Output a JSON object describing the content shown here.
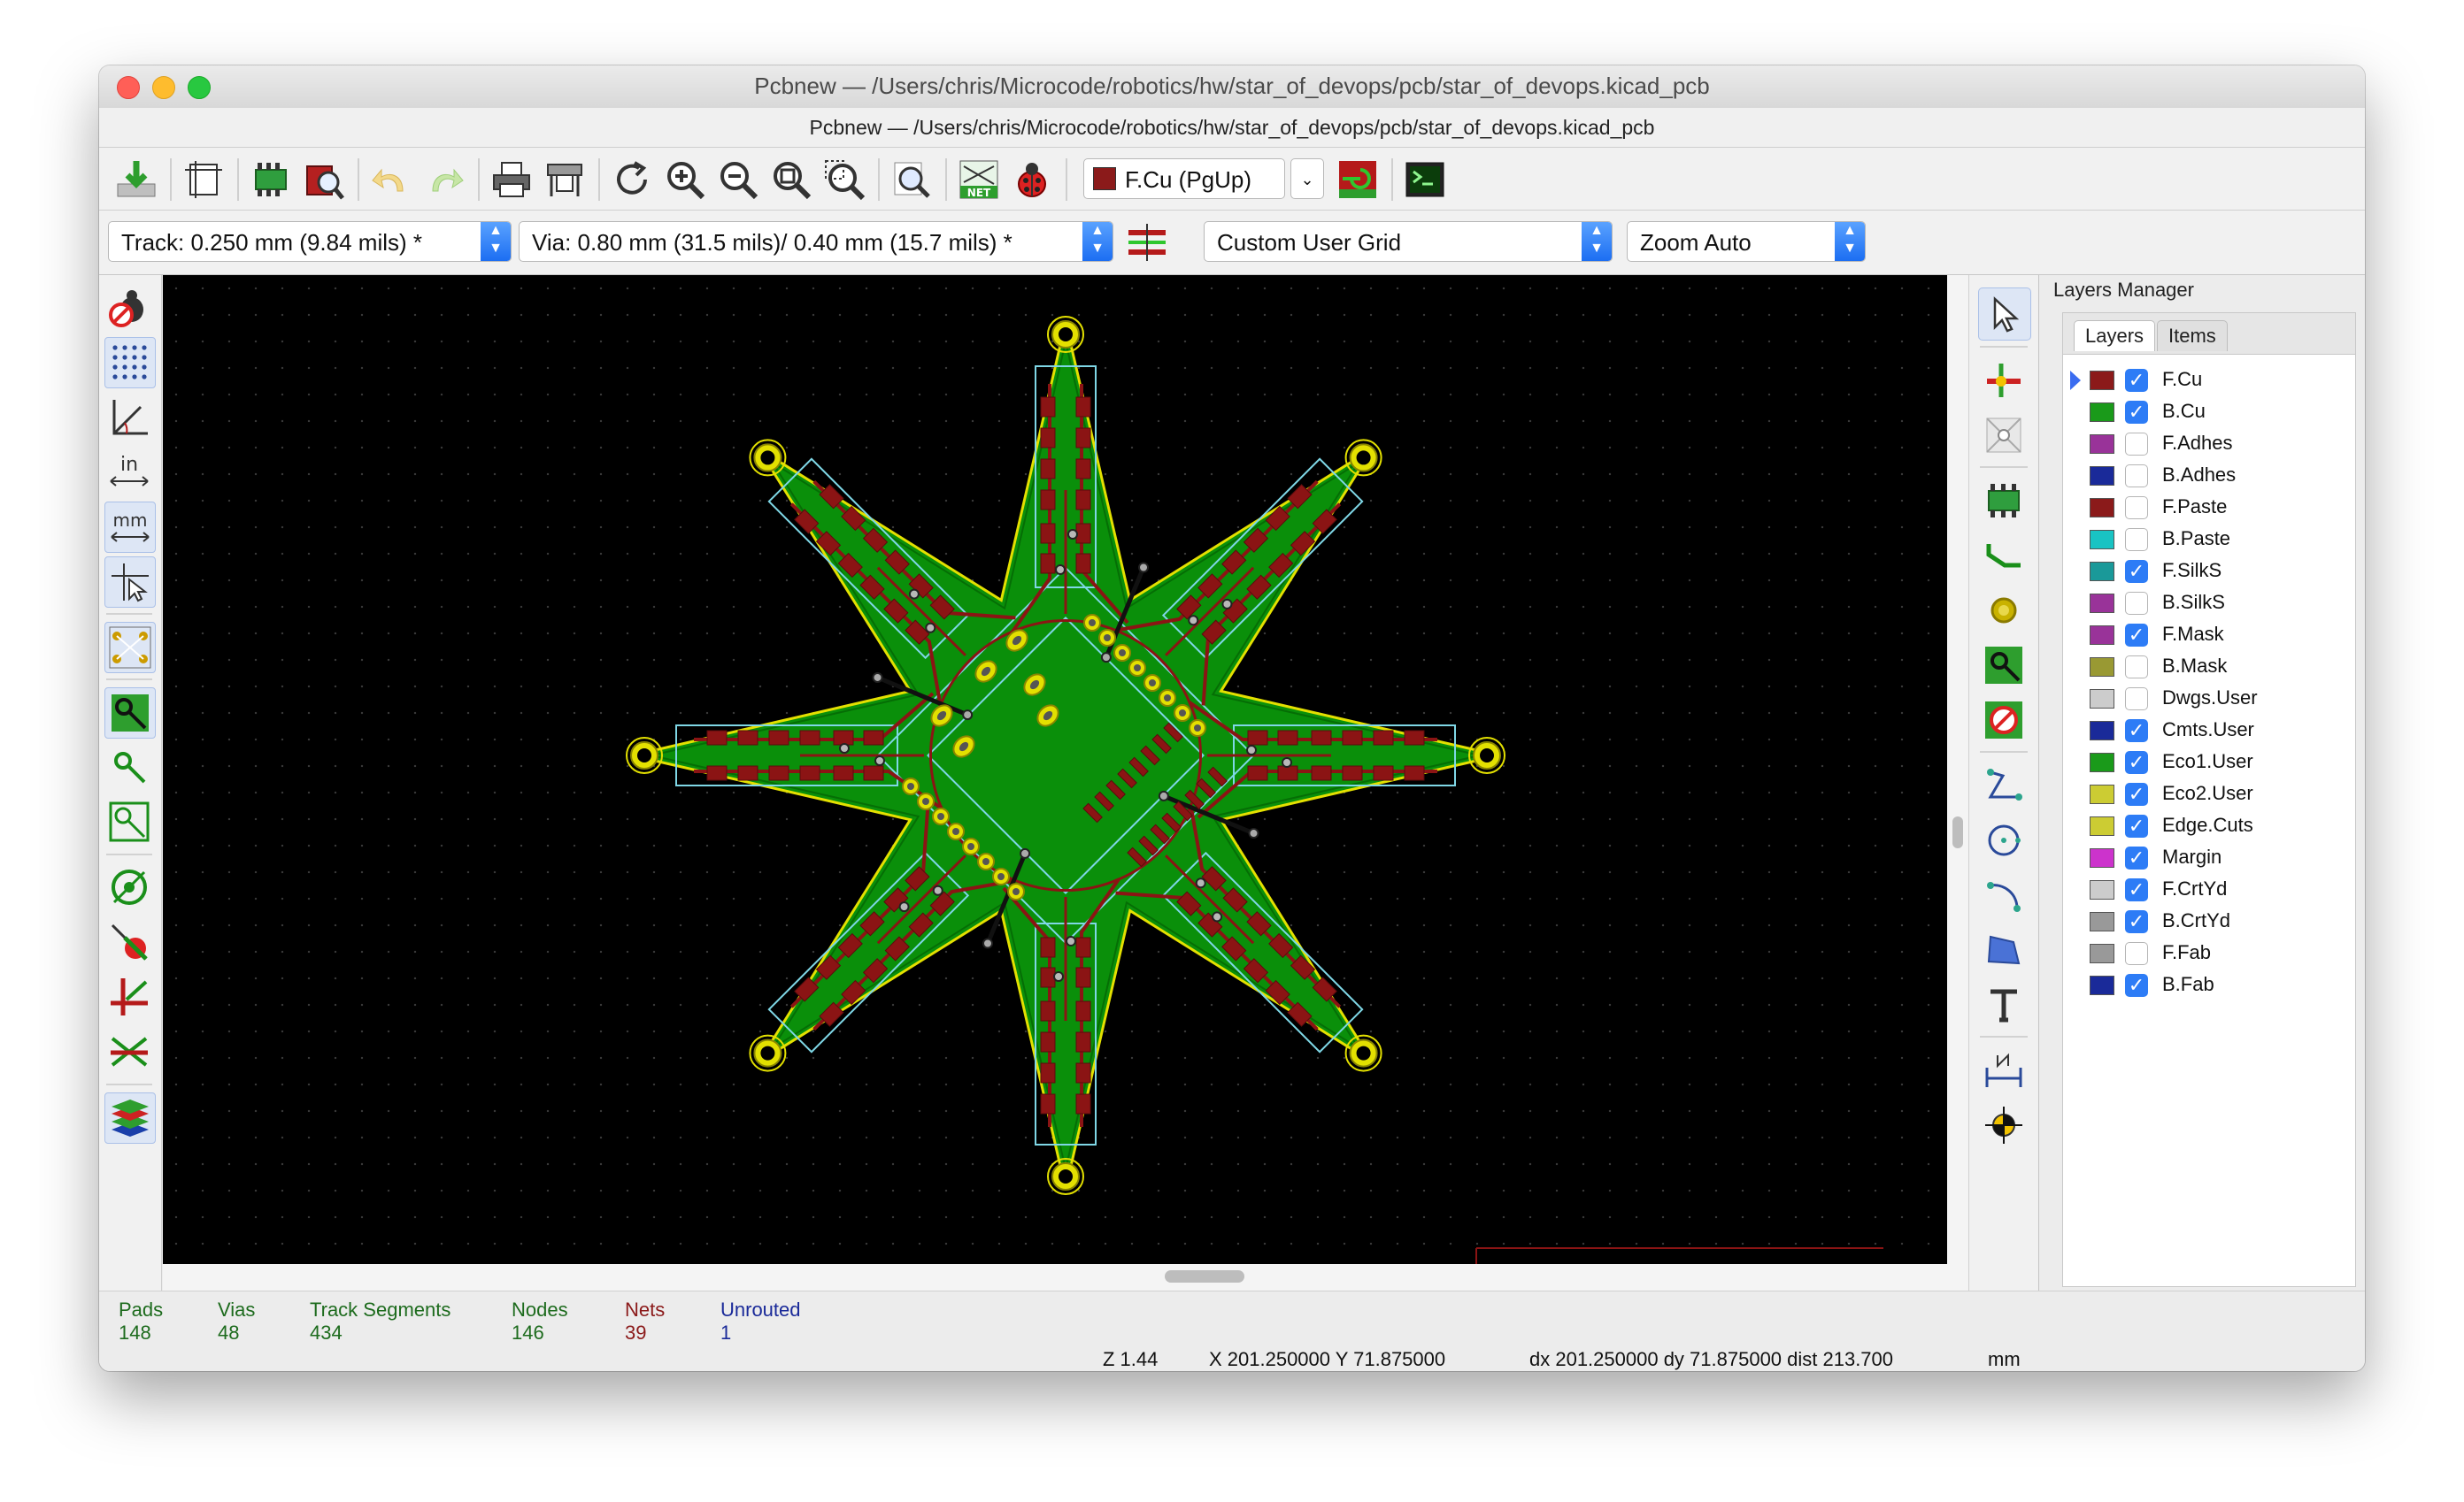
{
  "window": {
    "title": "Pcbnew — /Users/chris/Microcode/robotics/hw/star_of_devops/pcb/star_of_devops.kicad_pcb",
    "subtitle": "Pcbnew — /Users/chris/Microcode/robotics/hw/star_of_devops/pcb/star_of_devops.kicad_pcb"
  },
  "toolbar": {
    "active_layer": "F.Cu (PgUp)",
    "net_label": "NET"
  },
  "toolbar2": {
    "track_width": "Track: 0.250 mm (9.84 mils) *",
    "via_size": "Via: 0.80 mm (31.5 mils)/ 0.40 mm (15.7 mils) *",
    "grid": "Custom User Grid",
    "zoom": "Zoom Auto"
  },
  "left_toolbar": {
    "units_in": "in",
    "units_mm": "mm"
  },
  "layers_manager": {
    "title": "Layers Manager",
    "tabs": [
      "Layers",
      "Items"
    ],
    "layers": [
      {
        "name": "F.Cu",
        "color": "#8b1a1a",
        "visible": true,
        "active": true
      },
      {
        "name": "B.Cu",
        "color": "#1a9a1a",
        "visible": true
      },
      {
        "name": "F.Adhes",
        "color": "#993399",
        "visible": false
      },
      {
        "name": "B.Adhes",
        "color": "#1a2a99",
        "visible": false
      },
      {
        "name": "F.Paste",
        "color": "#8b1a1a",
        "visible": false
      },
      {
        "name": "B.Paste",
        "color": "#19c3c3",
        "visible": false
      },
      {
        "name": "F.SilkS",
        "color": "#1a9999",
        "visible": true
      },
      {
        "name": "B.SilkS",
        "color": "#993399",
        "visible": false
      },
      {
        "name": "F.Mask",
        "color": "#993399",
        "visible": true
      },
      {
        "name": "B.Mask",
        "color": "#999933",
        "visible": false
      },
      {
        "name": "Dwgs.User",
        "color": "#cccccc",
        "visible": false
      },
      {
        "name": "Cmts.User",
        "color": "#1a2a99",
        "visible": true
      },
      {
        "name": "Eco1.User",
        "color": "#1a9a1a",
        "visible": true
      },
      {
        "name": "Eco2.User",
        "color": "#cccc33",
        "visible": true
      },
      {
        "name": "Edge.Cuts",
        "color": "#cccc33",
        "visible": true
      },
      {
        "name": "Margin",
        "color": "#cc33cc",
        "visible": true
      },
      {
        "name": "F.CrtYd",
        "color": "#cccccc",
        "visible": true
      },
      {
        "name": "B.CrtYd",
        "color": "#999999",
        "visible": true
      },
      {
        "name": "F.Fab",
        "color": "#999999",
        "visible": false
      },
      {
        "name": "B.Fab",
        "color": "#1a2a99",
        "visible": true
      }
    ]
  },
  "status": {
    "stats": [
      {
        "label": "Pads",
        "value": "148",
        "color": "#1d6b1d"
      },
      {
        "label": "Vias",
        "value": "48",
        "color": "#1d6b1d"
      },
      {
        "label": "Track Segments",
        "value": "434",
        "color": "#1d6b1d"
      },
      {
        "label": "Nodes",
        "value": "146",
        "color": "#1d6b1d"
      },
      {
        "label": "Nets",
        "value": "39",
        "color": "#8b1a1a"
      },
      {
        "label": "Unrouted",
        "value": "1",
        "color": "#1a2a99"
      }
    ],
    "zoom": "Z 1.44",
    "xy": "X 201.250000  Y 71.875000",
    "delta": "dx 201.250000  dy 71.875000  dist 213.700",
    "units": "mm"
  },
  "colors": {
    "board_fill": "#0a8f0a",
    "edge_cuts": "#e3e000",
    "copper": "#8b1414",
    "silkscreen": "#7fd7e6"
  }
}
